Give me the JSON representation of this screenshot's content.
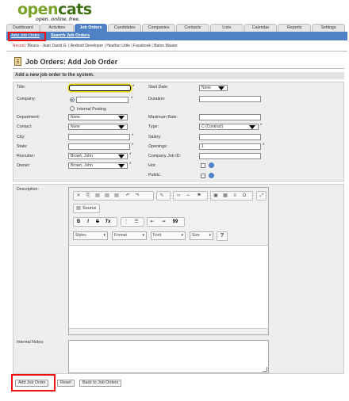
{
  "brand": {
    "logo_left": "open",
    "logo_right": "cats",
    "tagline": "open. online. free."
  },
  "tabs": [
    "Dashboard",
    "Activities",
    "Job Orders",
    "Candidates",
    "Companies",
    "Contacts",
    "Lists",
    "Calendar",
    "Reports",
    "Settings"
  ],
  "active_tab": "Job Orders",
  "subnav": {
    "add": "Add Job Order",
    "search": "Search Job Orders"
  },
  "recent": {
    "label": "Recent:",
    "items": "Moura - Jean David G. | Android Developer | Heather Little | Facebook | Baton Master"
  },
  "page_title": "Job Orders: Add Job Order",
  "subtitle": "Add a new job order to the system.",
  "form_left": {
    "title": "Title:",
    "company": "Company:",
    "internal_posting": "Internal Posting",
    "department": "Department:",
    "department_value": "None",
    "contact": "Contact:",
    "contact_value": "None",
    "city": "City:",
    "state": "State:",
    "recruiter": "Recruiter:",
    "recruiter_value": "Brown, John",
    "owner": "Owner:",
    "owner_value": "Brown, John"
  },
  "form_right": {
    "start_date": "Start Date:",
    "start_date_value": "None",
    "duration": "Duration:",
    "max_rate": "Maximum Rate:",
    "type": "Type:",
    "type_value": "C (Contract)",
    "salary": "Salary:",
    "openings": "Openings:",
    "openings_value": "1",
    "company_job_id": "Company Job ID:",
    "hot": "Hot:",
    "public": "Public:"
  },
  "required_mark": "*",
  "description": "Description:",
  "editor": {
    "source": "Source",
    "styles": "Styles",
    "format": "Format",
    "font": "Font",
    "size": "Size",
    "help": "?",
    "bold": "B",
    "italic": "I",
    "strike": "S",
    "clear": "Tx",
    "quote": "99",
    "omega": "Ω"
  },
  "internal_notes": "Internal Notes:",
  "buttons": {
    "add": "Add Job Order",
    "reset": "Reset",
    "back": "Back to Job Orders"
  },
  "colors": {
    "accent": "#4f82c5",
    "logo_green": "#7aa32b",
    "highlight": "#e11111"
  }
}
